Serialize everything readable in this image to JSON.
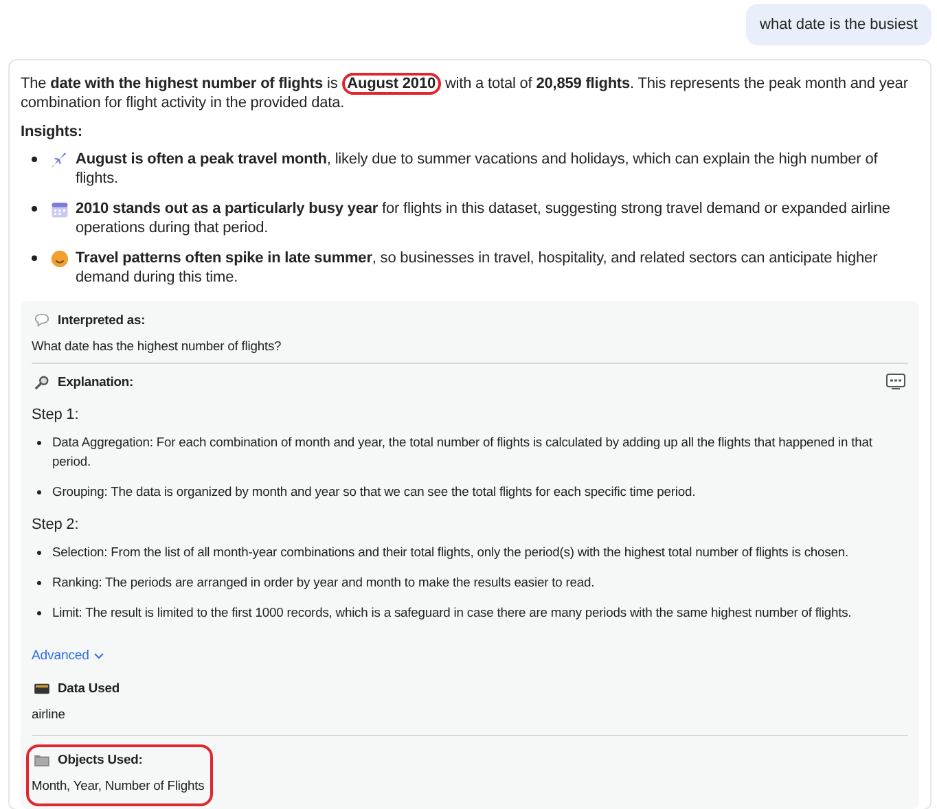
{
  "user_message": {
    "text": "what date is the busiest"
  },
  "answer": {
    "summary": [
      {
        "text": "The **date with the highest number of flights** is ",
        "circled": false
      },
      {
        "text": "**August 2010**",
        "circled": true
      },
      {
        "text": " with a total of **20,859 flights**. This represents the peak month and year combination for flight activity in the provided data.",
        "circled": false
      }
    ],
    "insights_heading": "Insights:",
    "insights": [
      {
        "kind": "airplane",
        "text": "**August is often a peak travel month**, likely due to summer vacations and holidays, which can explain the high number of flights."
      },
      {
        "kind": "calendar",
        "text": "**2010 stands out as a particularly busy year** for flights in this dataset, suggesting strong travel demand or expanded airline operations during that period."
      },
      {
        "kind": "smiley",
        "text": "**Travel patterns often spike in late summer**, so businesses in travel, hospitality, and related sectors can anticipate higher demand during this time."
      }
    ]
  },
  "details": {
    "interpreted": {
      "label": "Interpreted as:",
      "text": "What date has the highest number of flights?"
    },
    "explanation": {
      "label": "Explanation:",
      "steps": [
        {
          "title": "Step 1:",
          "bullets": [
            "Data Aggregation: For each combination of month and year, the total number of flights is calculated by adding up all the flights that happened in that period.",
            "Grouping: The data is organized by month and year so that we can see the total flights for each specific time period."
          ]
        },
        {
          "title": "Step 2:",
          "bullets": [
            "Selection: From the list of all month-year combinations and their total flights, only the period(s) with the highest total number of flights is chosen.",
            "Ranking: The periods are arranged in order by year and month to make the results easier to read.",
            "Limit: The result is limited to the first 1000 records, which is a safeguard in case there are many periods with the same highest number of flights."
          ]
        }
      ]
    },
    "advanced_link": "Advanced",
    "data_used": {
      "label": "Data Used",
      "value": "airline",
      "circled": false
    },
    "objects_used": {
      "label": "Objects Used:",
      "value": "Month, Year, Number of Flights",
      "circled": true
    }
  }
}
